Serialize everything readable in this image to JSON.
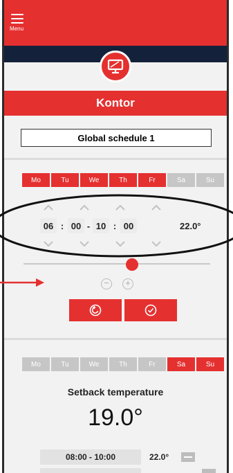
{
  "header": {
    "menu_label": "Menu"
  },
  "device": {
    "icon": "monitor-icon"
  },
  "room": {
    "name": "Kontor"
  },
  "schedule": {
    "name": "Global schedule 1"
  },
  "period_editor": {
    "days": [
      {
        "label": "Mo",
        "active": true
      },
      {
        "label": "Tu",
        "active": true
      },
      {
        "label": "We",
        "active": true
      },
      {
        "label": "Th",
        "active": true
      },
      {
        "label": "Fr",
        "active": true
      },
      {
        "label": "Sa",
        "active": false
      },
      {
        "label": "Su",
        "active": false
      }
    ],
    "start_hour": "06",
    "start_min": "00",
    "end_hour": "10",
    "end_min": "00",
    "colon": ":",
    "dash": "-",
    "temperature": "22.0°",
    "slider_level": 0.58,
    "minus_symbol": "−",
    "plus_symbol": "+",
    "buttons": {
      "undo_icon": "undo-icon",
      "confirm_icon": "check-icon"
    }
  },
  "setback_section": {
    "days": [
      {
        "label": "Mo",
        "active": false
      },
      {
        "label": "Tu",
        "active": false
      },
      {
        "label": "We",
        "active": false
      },
      {
        "label": "Th",
        "active": false
      },
      {
        "label": "Fr",
        "active": false
      },
      {
        "label": "Sa",
        "active": true
      },
      {
        "label": "Su",
        "active": true
      }
    ],
    "title": "Setback temperature",
    "temperature": "19.0°",
    "periods": [
      {
        "time": "08:00 - 10:00",
        "temperature": "22.0°"
      }
    ]
  },
  "colors": {
    "accent": "#e53030",
    "navy": "#14213b",
    "inactive_day": "#c6c6c6"
  }
}
